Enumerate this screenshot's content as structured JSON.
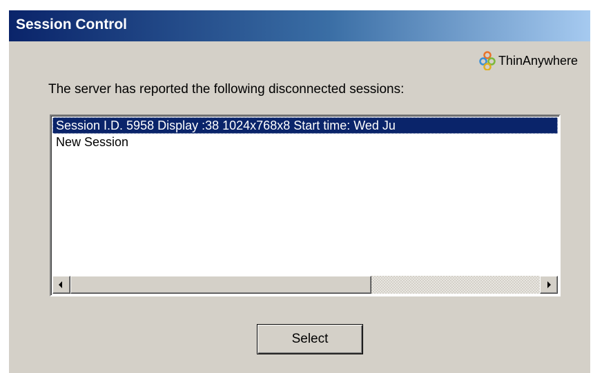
{
  "window": {
    "title": "Session Control"
  },
  "branding": {
    "logo_text": "ThinAnywhere",
    "logo_icon": "thinanywhere-logo-icon"
  },
  "prompt_text": "The server has reported the following disconnected sessions:",
  "sessions_list": {
    "items": [
      {
        "label": "Session I.D. 5958   Display :38  1024x768x8          Start time: Wed Ju",
        "selected": true
      },
      {
        "label": "New Session",
        "selected": false
      }
    ],
    "scrollbar_icons": [
      "scroll-left-arrow-icon",
      "scroll-right-arrow-icon"
    ]
  },
  "actions": {
    "select_label": "Select"
  },
  "colors": {
    "title_gradient_start": "#0a246a",
    "title_gradient_end": "#a6caf0",
    "dialog_background": "#d4d0c8",
    "selection": "#0a246a"
  }
}
